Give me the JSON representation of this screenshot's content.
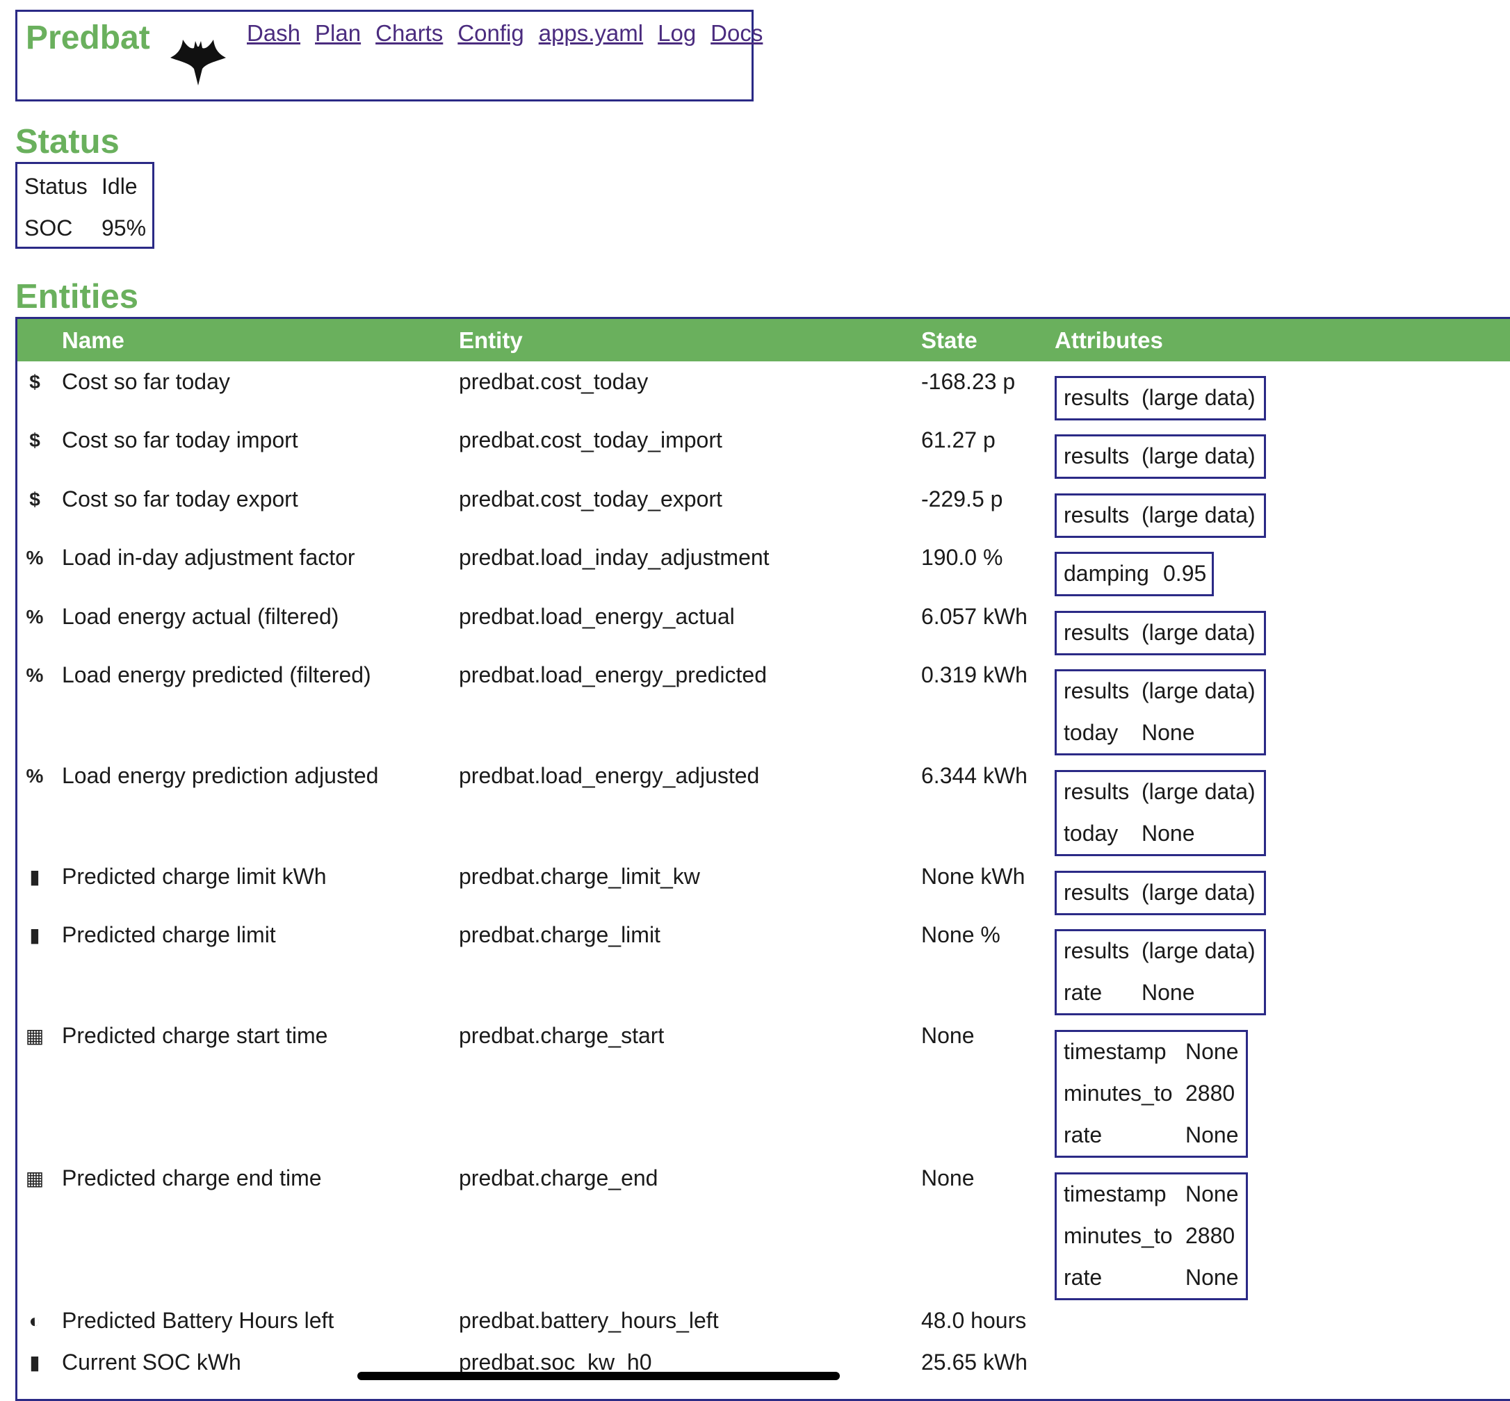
{
  "header": {
    "brand": "Predbat",
    "nav": [
      "Dash",
      "Plan",
      "Charts",
      "Config",
      "apps.yaml",
      "Log",
      "Docs"
    ]
  },
  "status_section": {
    "title": "Status",
    "rows": [
      {
        "key": "Status",
        "value": "Idle"
      },
      {
        "key": "SOC",
        "value": "95%"
      }
    ]
  },
  "entities_section": {
    "title": "Entities",
    "columns": [
      "Name",
      "Entity",
      "State",
      "Attributes"
    ],
    "rows": [
      {
        "icon": "dollar-icon",
        "glyph": "$",
        "name": "Cost so far today",
        "entity": "predbat.cost_today",
        "state": "-168.23 p",
        "attributes": [
          {
            "k": "results",
            "v": "(large data)"
          }
        ]
      },
      {
        "icon": "dollar-icon",
        "glyph": "$",
        "name": "Cost so far today import",
        "entity": "predbat.cost_today_import",
        "state": "61.27 p",
        "attributes": [
          {
            "k": "results",
            "v": "(large data)"
          }
        ]
      },
      {
        "icon": "dollar-icon",
        "glyph": "$",
        "name": "Cost so far today export",
        "entity": "predbat.cost_today_export",
        "state": "-229.5 p",
        "attributes": [
          {
            "k": "results",
            "v": "(large data)"
          }
        ]
      },
      {
        "icon": "percent-icon",
        "glyph": "%",
        "name": "Load in-day adjustment factor",
        "entity": "predbat.load_inday_adjustment",
        "state": "190.0 %",
        "attributes": [
          {
            "k": "damping",
            "v": "0.95"
          }
        ]
      },
      {
        "icon": "percent-icon",
        "glyph": "%",
        "name": "Load energy actual (filtered)",
        "entity": "predbat.load_energy_actual",
        "state": "6.057 kWh",
        "attributes": [
          {
            "k": "results",
            "v": "(large data)"
          }
        ]
      },
      {
        "icon": "percent-icon",
        "glyph": "%",
        "name": "Load energy predicted (filtered)",
        "entity": "predbat.load_energy_predicted",
        "state": "0.319 kWh",
        "attributes": [
          {
            "k": "results",
            "v": "(large data)"
          },
          {
            "k": "today",
            "v": "None"
          }
        ]
      },
      {
        "icon": "percent-icon",
        "glyph": "%",
        "name": "Load energy prediction adjusted",
        "entity": "predbat.load_energy_adjusted",
        "state": "6.344 kWh",
        "attributes": [
          {
            "k": "results",
            "v": "(large data)"
          },
          {
            "k": "today",
            "v": "None"
          }
        ]
      },
      {
        "icon": "battery-charging-icon",
        "glyph": "▮",
        "name": "Predicted charge limit kWh",
        "entity": "predbat.charge_limit_kw",
        "state": "None kWh",
        "attributes": [
          {
            "k": "results",
            "v": "(large data)"
          }
        ]
      },
      {
        "icon": "battery-charging-icon",
        "glyph": "▮",
        "name": "Predicted charge limit",
        "entity": "predbat.charge_limit",
        "state": "None %",
        "attributes": [
          {
            "k": "results",
            "v": "(large data)"
          },
          {
            "k": "rate",
            "v": "None"
          }
        ]
      },
      {
        "icon": "calendar-clock-icon",
        "glyph": "▦",
        "name": "Predicted charge start time",
        "entity": "predbat.charge_start",
        "state": "None",
        "attributes": [
          {
            "k": "timestamp",
            "v": "None"
          },
          {
            "k": "minutes_to",
            "v": "2880"
          },
          {
            "k": "rate",
            "v": "None"
          }
        ]
      },
      {
        "icon": "calendar-clock-icon",
        "glyph": "▦",
        "name": "Predicted charge end time",
        "entity": "predbat.charge_end",
        "state": "None",
        "attributes": [
          {
            "k": "timestamp",
            "v": "None"
          },
          {
            "k": "minutes_to",
            "v": "2880"
          },
          {
            "k": "rate",
            "v": "None"
          }
        ]
      },
      {
        "icon": "timelapse-icon",
        "glyph": "◐",
        "name": "Predicted Battery Hours left",
        "entity": "predbat.battery_hours_left",
        "state": "48.0 hours",
        "attributes": []
      },
      {
        "icon": "battery-icon",
        "glyph": "▮",
        "name": "Current SOC kWh",
        "entity": "predbat.soc_kw_h0",
        "state": "25.65 kWh",
        "attributes": []
      }
    ]
  },
  "colors": {
    "accent": "#6ab05d",
    "border": "#2b2a86",
    "link": "#4b2c7f"
  }
}
